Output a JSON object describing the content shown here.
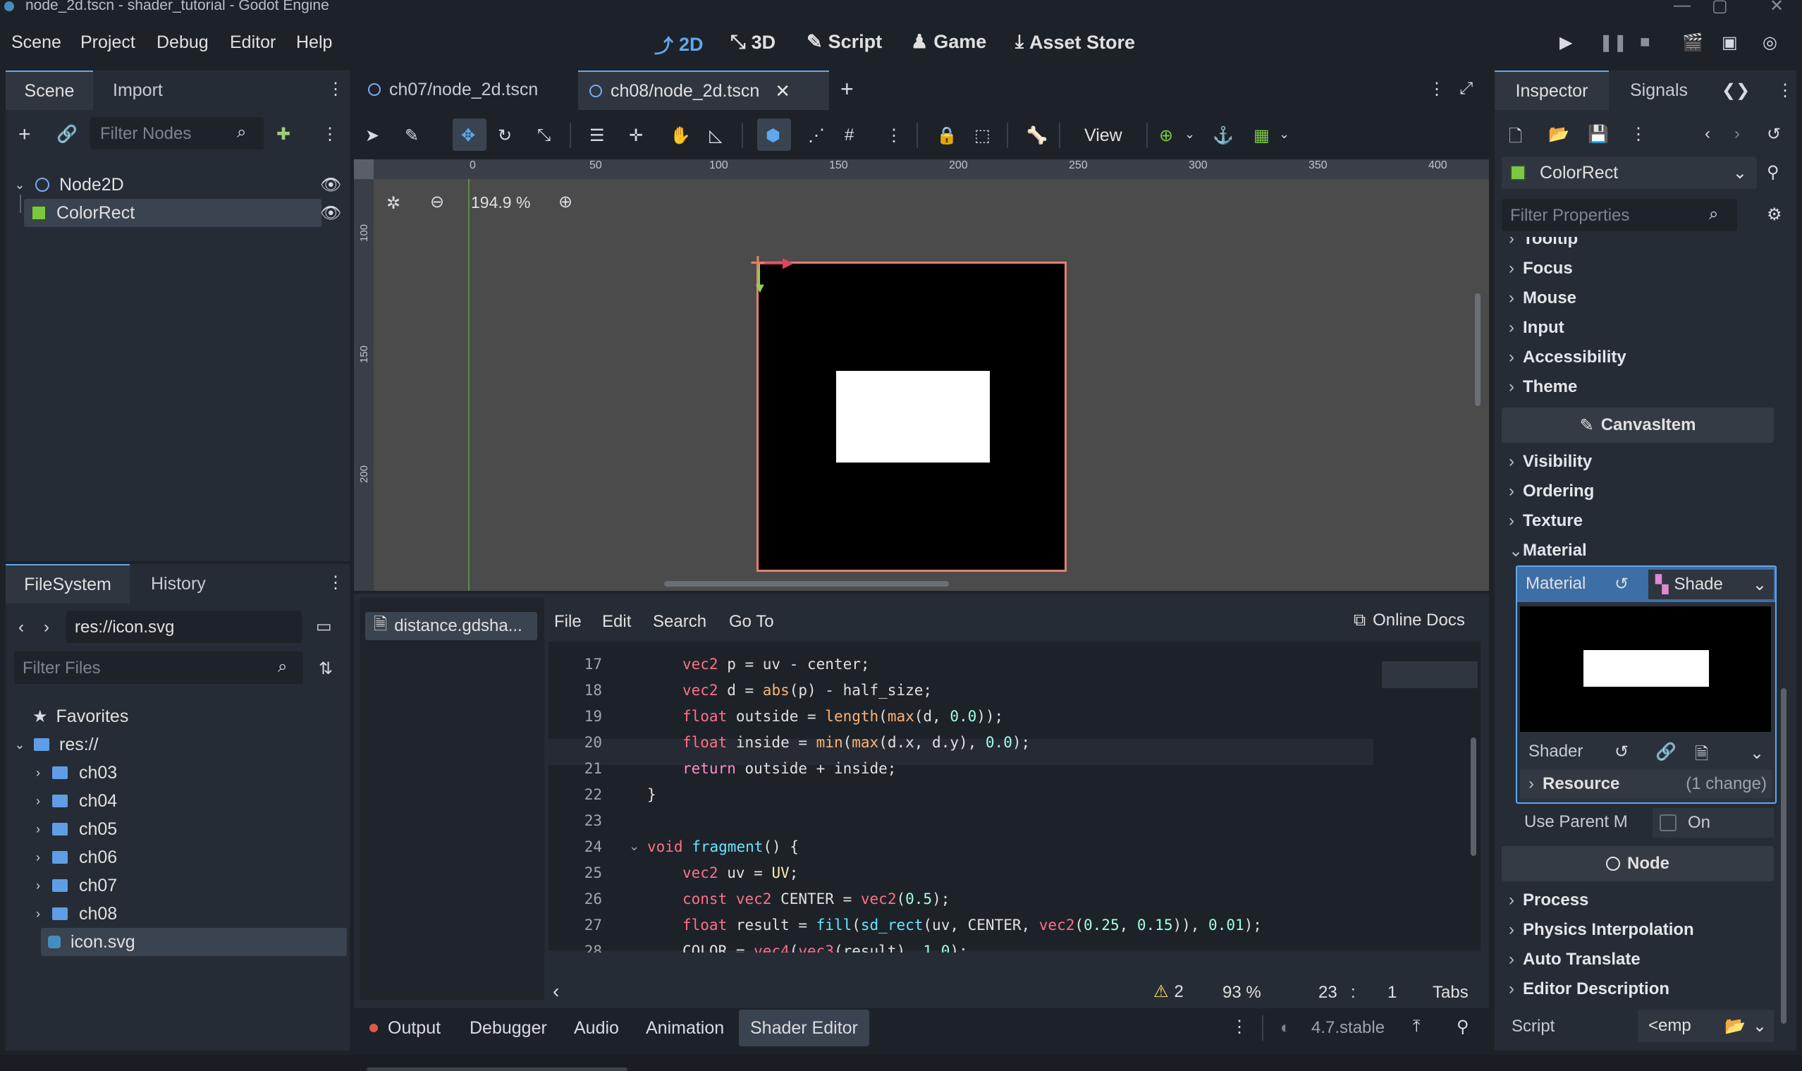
{
  "title_bar": {
    "text": "node_2d.tscn - shader_tutorial - Godot Engine"
  },
  "menu": [
    "Scene",
    "Project",
    "Debug",
    "Editor",
    "Help"
  ],
  "workspaces": {
    "w2d": "2D",
    "w3d": "3D",
    "script": "Script",
    "game": "Game",
    "asset": "Asset Store"
  },
  "scene_dock": {
    "tab_scene": "Scene",
    "tab_import": "Import",
    "filter_placeholder": "Filter Nodes",
    "nodes": [
      {
        "name": "Node2D"
      },
      {
        "name": "ColorRect"
      }
    ]
  },
  "scene_tabs": [
    {
      "label": "ch07/node_2d.tscn"
    },
    {
      "label": "ch08/node_2d.tscn"
    }
  ],
  "toolbar": {
    "view": "View"
  },
  "viewport": {
    "zoom": "194.9 %",
    "ruler_top": [
      "0",
      "50",
      "100",
      "150",
      "200",
      "250",
      "300",
      "350",
      "400"
    ],
    "ruler_left": [
      "100",
      "150",
      "200"
    ]
  },
  "filesystem": {
    "tab_fs": "FileSystem",
    "tab_history": "History",
    "path": "res://icon.svg",
    "filter_placeholder": "Filter Files",
    "favorites": "Favorites",
    "root": "res://",
    "folders": [
      "ch03",
      "ch04",
      "ch05",
      "ch06",
      "ch07",
      "ch08"
    ],
    "file": "icon.svg"
  },
  "shader_editor": {
    "file_tab": "distance.gdsha...",
    "menu": [
      "File",
      "Edit",
      "Search",
      "Go To"
    ],
    "online_docs": "Online Docs",
    "line_numbers": [
      "17",
      "18",
      "19",
      "20",
      "21",
      "22",
      "23",
      "24",
      "25",
      "26",
      "27",
      "28"
    ],
    "warnings": "2",
    "zoom": "93 %",
    "line": "23",
    "col": "1",
    "indent": "Tabs"
  },
  "bottom_tabs": [
    "Output",
    "Debugger",
    "Audio",
    "Animation",
    "Shader Editor"
  ],
  "version": "4.7.stable",
  "inspector": {
    "tab_inspector": "Inspector",
    "tab_signals": "Signals",
    "node_type": "ColorRect",
    "filter_placeholder": "Filter Properties",
    "sections_top": [
      "Tooltip",
      "Focus",
      "Mouse",
      "Input",
      "Accessibility",
      "Theme"
    ],
    "canvasitem": "CanvasItem",
    "sections_mid": [
      "Visibility",
      "Ordering",
      "Texture"
    ],
    "material_section": "Material",
    "material_label": "Material",
    "material_value": "Shade",
    "shader_label": "Shader",
    "resource_label": "Resource",
    "resource_changes": "(1 change)",
    "use_parent": "Use Parent M",
    "use_parent_value": "On",
    "node_header": "Node",
    "sections_bottom": [
      "Process",
      "Physics Interpolation",
      "Auto Translate",
      "Editor Description"
    ],
    "script_label": "Script",
    "script_value": "<emp"
  },
  "colors": {
    "accent": "#5fa8f0",
    "selection": "#3a4350",
    "panel": "#262c35",
    "bg": "#1d2229",
    "selection_outline": "#e0826a"
  }
}
